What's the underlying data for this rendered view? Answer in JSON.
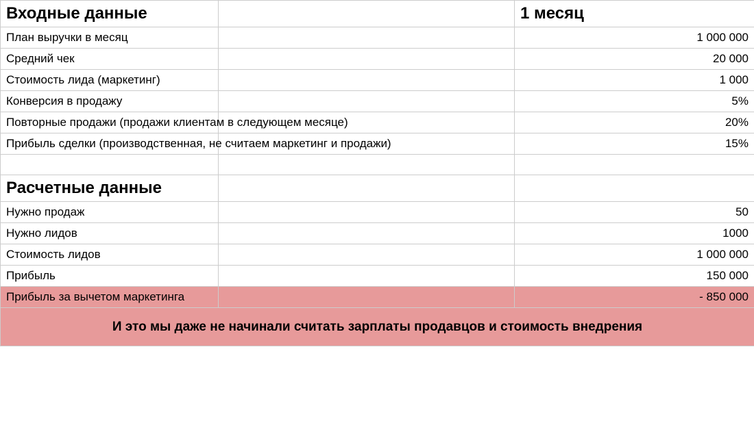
{
  "sections": {
    "input_header": "Входные данные",
    "calc_header": "Расчетные данные"
  },
  "month_label": "1 месяц",
  "input_rows": [
    {
      "label": "План выручки в месяц",
      "value": "1 000 000"
    },
    {
      "label": "Средний чек",
      "value": "20 000"
    },
    {
      "label": "Стоимость лида (маркетинг)",
      "value": "1 000"
    },
    {
      "label": "Конверсия в продажу",
      "value": "5%"
    },
    {
      "label": "Повторные продажи (продажи клиентам в следующем месяце)",
      "value": "20%"
    },
    {
      "label": "Прибыль сделки (производственная, не считаем маркетинг и продажи)",
      "value": "15%"
    }
  ],
  "calc_rows": [
    {
      "label": "Нужно продаж",
      "value": "50"
    },
    {
      "label": "Нужно лидов",
      "value": "1000"
    },
    {
      "label": "Стоимость лидов",
      "value": "1 000 000"
    },
    {
      "label": "Прибыль",
      "value": "150 000"
    }
  ],
  "highlight_row": {
    "label": "Прибыль за вычетом маркетинга",
    "value": "- 850 000"
  },
  "footer_note": "И это мы даже не начинали считать зарплаты продавцов и стоимость внедрения"
}
